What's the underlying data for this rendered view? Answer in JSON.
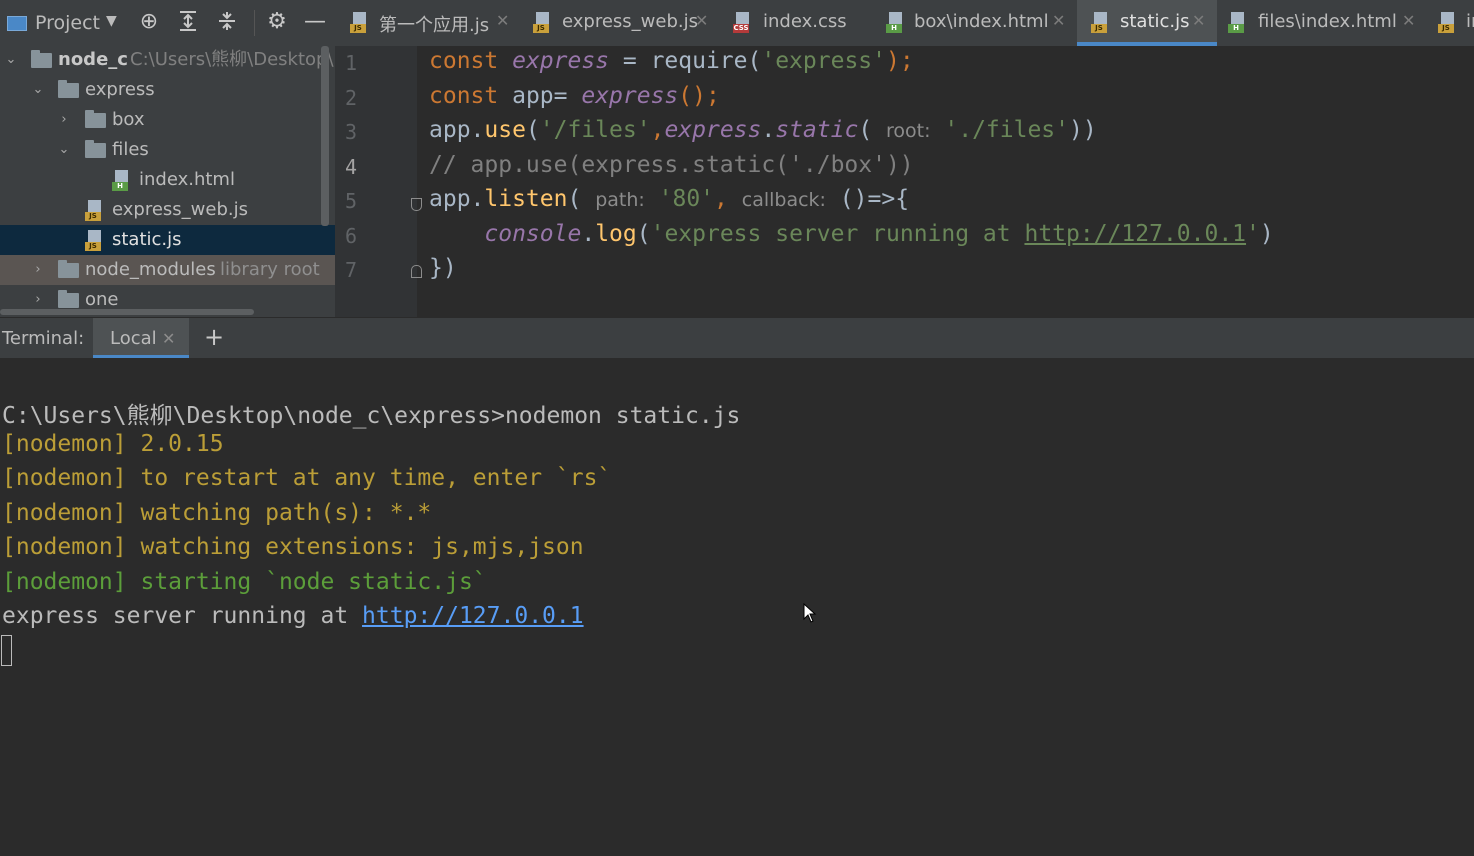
{
  "project_panel": {
    "title": "Project",
    "tree": [
      {
        "label": "node_c",
        "path": "C:\\Users\\熊柳\\Desktop\\r"
      },
      {
        "label": "express"
      },
      {
        "label": "box"
      },
      {
        "label": "files"
      },
      {
        "label": "index.html"
      },
      {
        "label": "express_web.js"
      },
      {
        "label": "static.js"
      },
      {
        "label": "node_modules",
        "note": "library root"
      },
      {
        "label": "one"
      }
    ]
  },
  "tabs": [
    {
      "label": "第一个应用.js",
      "type": "js"
    },
    {
      "label": "express_web.js",
      "type": "js"
    },
    {
      "label": "index.css",
      "type": "css"
    },
    {
      "label": "box\\index.html",
      "type": "h"
    },
    {
      "label": "static.js",
      "type": "js",
      "active": true
    },
    {
      "label": "files\\index.html",
      "type": "h"
    },
    {
      "label": "in",
      "type": "js"
    }
  ],
  "editor": {
    "line_numbers": [
      "1",
      "2",
      "3",
      "4",
      "5",
      "6",
      "7"
    ],
    "code": {
      "l1": {
        "kw": "const ",
        "name": "express",
        "eq": " = require(",
        "str": "'express'",
        "end": ");"
      },
      "l2": {
        "kw": "const ",
        "plain": "app= ",
        "name": "express",
        "end": "();"
      },
      "l3": {
        "obj": "app.",
        "fn": "use",
        "open": "(",
        "str1": "'/files'",
        "comma": ",",
        "name": "express",
        "dot": ".",
        "static": "static",
        "paren": "( ",
        "hint": "root:",
        "str2": " './files'",
        "end": "))"
      },
      "l4": {
        "comment": "// app.use(express.static('./box'))"
      },
      "l5": {
        "obj": "app.",
        "fn": "listen",
        "open": "( ",
        "hint1": "path:",
        "str": " '80'",
        "comma": ", ",
        "hint2": "callback:",
        "end": " ()=>{"
      },
      "l6": {
        "indent": "    ",
        "obj": "console",
        "dot": ".",
        "fn": "log",
        "open": "(",
        "str": "'express server running at ",
        "url": "http://127.0.0.1",
        "str_end": "'",
        "end": ")"
      },
      "l7": {
        "end": "})"
      }
    }
  },
  "terminal": {
    "label": "Terminal:",
    "tab": "Local",
    "lines": [
      {
        "text": "C:\\Users\\熊柳\\Desktop\\node_c\\express>nodemon static.js",
        "color": "white"
      },
      {
        "text": "[nodemon] 2.0.15",
        "color": "yellow"
      },
      {
        "text": "[nodemon] to restart at any time, enter `rs`",
        "color": "yellow"
      },
      {
        "text": "[nodemon] watching path(s): *.*",
        "color": "yellow"
      },
      {
        "text": "[nodemon] watching extensions: js,mjs,json",
        "color": "yellow"
      },
      {
        "text": "[nodemon] starting `node static.js`",
        "color": "green"
      }
    ],
    "last_line_prefix": "express server running at ",
    "last_line_link": "http://127.0.0.1"
  },
  "colors": {
    "keyword": "#cc7832",
    "string": "#6a8759",
    "italic_purple": "#9876aa",
    "function": "#ffc66d",
    "accent": "#4a88c7"
  }
}
